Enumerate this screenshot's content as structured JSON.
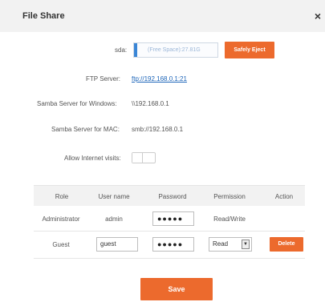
{
  "dialog": {
    "title": "File Share",
    "close_glyph": "×"
  },
  "sda": {
    "label": "sda:",
    "space_text": "(Free Space):27.81G",
    "eject_label": "Safely Eject"
  },
  "ftp": {
    "label": "FTP Server:",
    "link": "ftp://192.168.0.1:21"
  },
  "samba_windows": {
    "label": "Samba Server for Windows:",
    "value": "\\\\192.168.0.1"
  },
  "samba_mac": {
    "label": "Samba Server for MAC:",
    "value": "smb://192.168.0.1"
  },
  "internet": {
    "label": "Allow Internet visits:",
    "enabled": false
  },
  "table": {
    "headers": [
      "Role",
      "User name",
      "Password",
      "Permission",
      "Action"
    ],
    "rows": [
      {
        "role": "Administrator",
        "username": "admin",
        "password": "●●●●●",
        "permission": "Read/Write",
        "action": ""
      },
      {
        "role": "Guest",
        "username": "guest",
        "password": "●●●●●",
        "permission": "Read",
        "action": "Delete"
      }
    ]
  },
  "footer": {
    "save_label": "Save"
  },
  "colors": {
    "accent": "#ec6a2d",
    "link": "#1a63b8",
    "header_bg": "#f2f2f2"
  },
  "icons": {
    "close": "close-icon",
    "dropdown": "chevron-down-icon"
  }
}
